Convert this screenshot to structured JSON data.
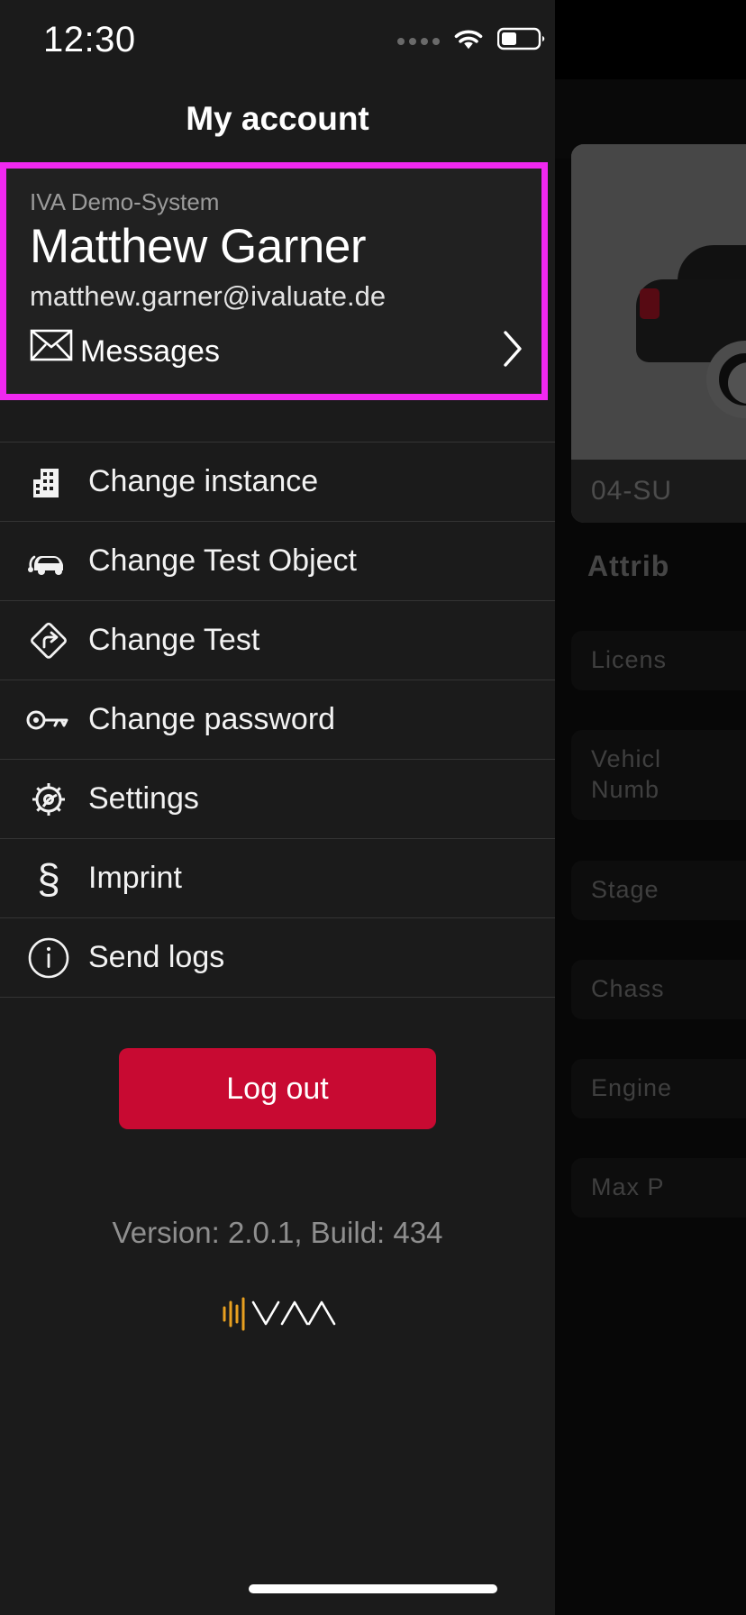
{
  "status_bar": {
    "time": "12:30",
    "signal_icon": "signal-dots-icon",
    "wifi_icon": "wifi-icon",
    "battery_icon": "battery-icon"
  },
  "app_bar": {
    "title": "My account",
    "menu_icon": "hamburger-menu-icon"
  },
  "profile": {
    "instance": "IVA Demo-System",
    "name": "Matthew Garner",
    "email": "matthew.garner@ivaluate.de",
    "messages_label": "Messages",
    "messages_icon": "envelope-icon",
    "chevron": "›",
    "highlight_color": "#f028f0"
  },
  "menu": {
    "items": [
      {
        "label": "Change instance",
        "icon": "building-icon"
      },
      {
        "label": "Change Test Object",
        "icon": "car-icon"
      },
      {
        "label": "Change Test",
        "icon": "road-sign-arrow-icon"
      },
      {
        "label": "Change password",
        "icon": "key-icon"
      },
      {
        "label": "Settings",
        "icon": "gear-icon"
      },
      {
        "label": "Imprint",
        "icon": "section-sign-icon"
      },
      {
        "label": "Send logs",
        "icon": "info-circle-icon"
      }
    ]
  },
  "footer": {
    "logout_label": "Log out",
    "logout_color": "#c80a32",
    "version": "Version: 2.0.1, Build: 434",
    "logo_name": "iva-wave-logo"
  },
  "background_page": {
    "card_caption": "04-SU",
    "attributes_title": "Attrib",
    "attribute_rows": [
      "Licens",
      "Vehicl\nNumb",
      "Stage",
      "Chass",
      "Engine",
      "Max P"
    ]
  }
}
